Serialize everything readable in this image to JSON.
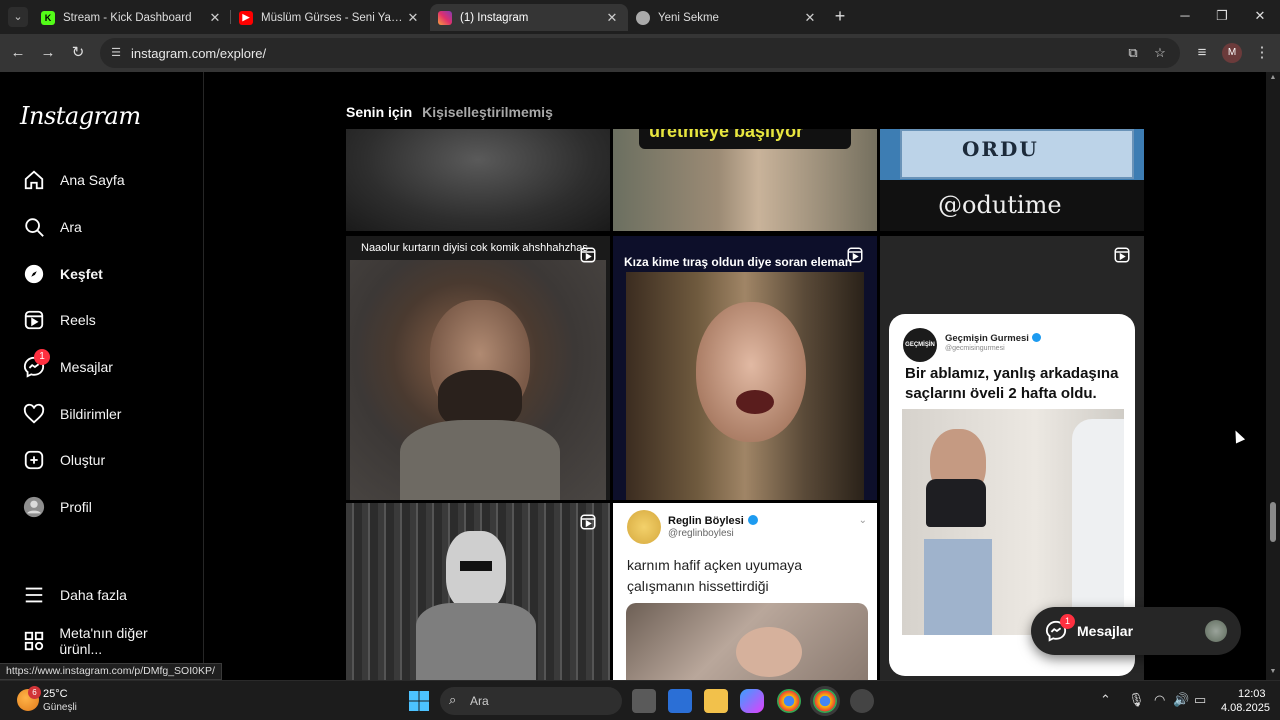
{
  "browser": {
    "tabs": [
      {
        "title": "Stream - Kick Dashboard",
        "favicon": "kick-logo",
        "color": "#53fc18"
      },
      {
        "title": "Müslüm Gürses - Seni Yazdım",
        "favicon": "youtube-logo",
        "color": "#ff0000"
      },
      {
        "title": "(1) Instagram",
        "favicon": "instagram-logo",
        "color": "#e1306c",
        "active": true
      },
      {
        "title": "Yeni Sekme",
        "favicon": "chrome-logo",
        "color": "#aaaaaa"
      }
    ],
    "url": "instagram.com/explore/",
    "profile_initial": "M",
    "status_link": "https://www.instagram.com/p/DMfg_SOI0KP/"
  },
  "sidebar": {
    "logo": "Instagram",
    "items": [
      {
        "label": "Ana Sayfa",
        "icon": "home-icon"
      },
      {
        "label": "Ara",
        "icon": "search-icon"
      },
      {
        "label": "Keşfet",
        "icon": "compass-icon",
        "active": true
      },
      {
        "label": "Reels",
        "icon": "reels-icon"
      },
      {
        "label": "Mesajlar",
        "icon": "messenger-icon",
        "badge": "1"
      },
      {
        "label": "Bildirimler",
        "icon": "heart-icon"
      },
      {
        "label": "Oluştur",
        "icon": "plus-square-icon"
      },
      {
        "label": "Profil",
        "icon": "profile-icon"
      }
    ],
    "more": {
      "label": "Daha fazla",
      "icon": "menu-icon"
    },
    "meta": {
      "label": "Meta'nın diğer ürünl...",
      "icon": "grid-icon"
    }
  },
  "explore": {
    "tabs": [
      "Senin için",
      "Kişiselleştirilmemiş"
    ],
    "tiles": {
      "t2_overlay": "üretmeye başlıyor",
      "t3_sign": "ORDU",
      "t3_handle": "@odutime",
      "t4_caption": "Naaolur kurtarın diyisi cok komik ahshhahzhas",
      "t5_caption": "Kıza kime tıraş oldun diye soran eleman",
      "t6_account": "Geçmişin Gurmesi",
      "t6_handle": "@gecmisingurmesi",
      "t6_avatar": "GEÇMİŞİN GURMESİ",
      "t6_title": "Bir ablamız, yanlış arkadaşına saçlarını öveli 2 hafta oldu.",
      "t8_account": "Reglin Böylesi",
      "t8_handle": "@reglinboylesi",
      "t8_text": "karnım hafif açken uyumaya çalışmanın hissettirdiği"
    }
  },
  "messages_float": {
    "label": "Mesajlar",
    "badge": "1"
  },
  "taskbar": {
    "weather_badge": "6",
    "temperature": "25°C",
    "weather": "Güneşli",
    "search_placeholder": "Ara",
    "time": "12:03",
    "date": "4.08.2025"
  }
}
